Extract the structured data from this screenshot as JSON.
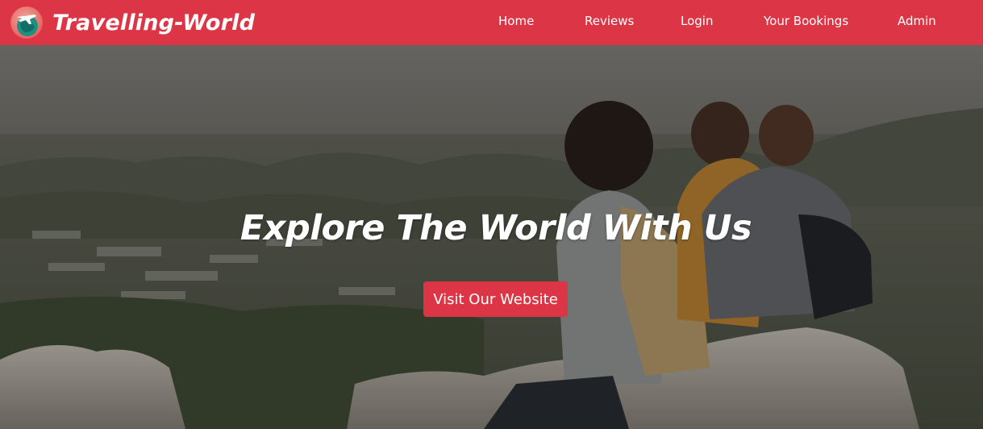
{
  "brand": {
    "name": "Travelling-World",
    "logo_icon": "globe-airplane-icon"
  },
  "nav": {
    "items": [
      {
        "label": "Home"
      },
      {
        "label": "Reviews"
      },
      {
        "label": "Login"
      },
      {
        "label": "Your Bookings"
      },
      {
        "label": "Admin"
      }
    ]
  },
  "hero": {
    "title": "Explore The World With Us",
    "button_label": "Visit Our Website",
    "image": "friends-with-backpacks-on-mountain-photo"
  },
  "colors": {
    "brand_red": "#dc3545",
    "text_white": "#ffffff"
  }
}
